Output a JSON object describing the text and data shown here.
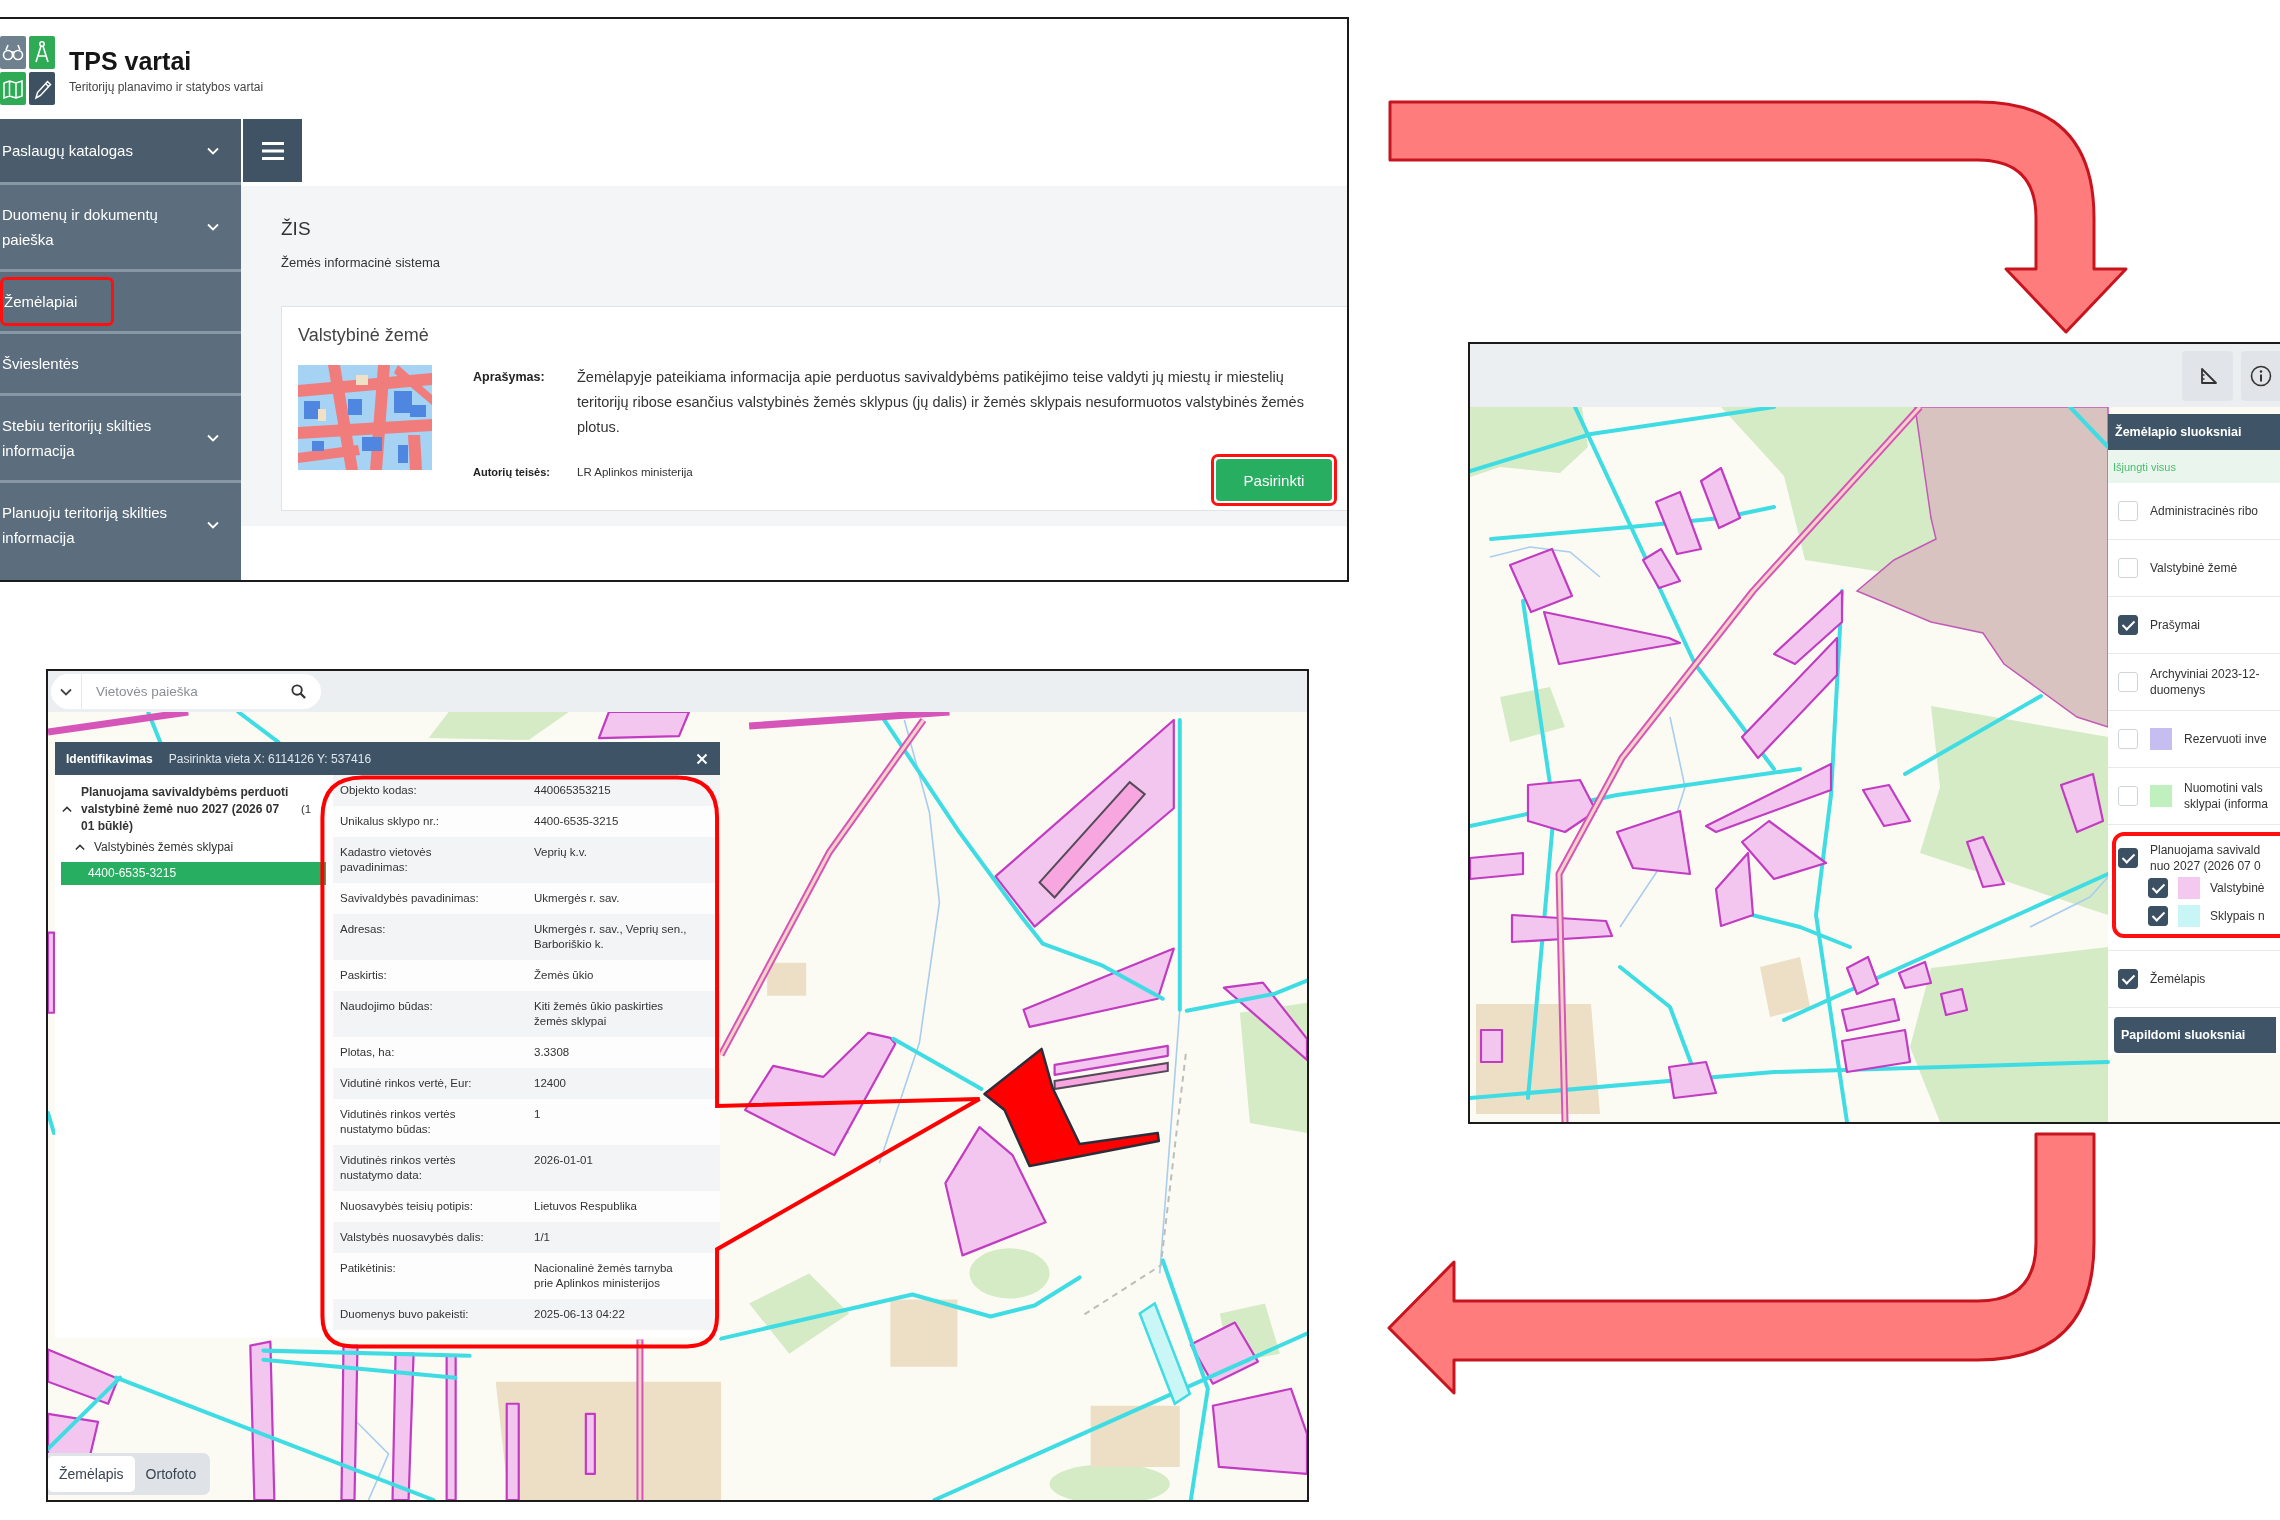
{
  "portal_window": {
    "brand": {
      "title": "TPS vartai",
      "subtitle": "Teritorijų planavimo ir statybos vartai"
    },
    "sidebar": [
      {
        "kind": "heading",
        "label": "Paslaugų katalogas",
        "expandable": true,
        "highlighted": false
      },
      {
        "kind": "entry",
        "label": "Duomenų ir dokumentų paieška",
        "expandable": true,
        "highlighted": false
      },
      {
        "kind": "entry",
        "label": "Žemėlapiai",
        "expandable": false,
        "highlighted": true
      },
      {
        "kind": "entry",
        "label": "Švieslentės",
        "expandable": false,
        "highlighted": false
      },
      {
        "kind": "entry",
        "label": "Stebiu teritorijų skilties informacija",
        "expandable": true,
        "highlighted": false
      },
      {
        "kind": "entry",
        "label": "Planuoju teritoriją skilties informacija",
        "expandable": true,
        "highlighted": false
      }
    ],
    "section": {
      "title": "ŽIS",
      "subtitle": "Žemės informacinė sistema"
    },
    "card": {
      "title": "Valstybinė žemė",
      "fields": [
        {
          "label": "Aprašymas:",
          "value": "Žemėlapyje pateikiama informacija apie perduotus savivaldybėms patikėjimo teise valdyti jų miestų ir miestelių teritorijų ribose esančius valstybinės žemės sklypus (jų dalis) ir žemės sklypais nesuformuotos valstybinės žemės plotus."
        },
        {
          "label": "Autorių teisės:",
          "value": "LR Aplinkos ministerija"
        }
      ],
      "button": {
        "label": "Pasirinkti",
        "highlighted": true
      }
    }
  },
  "layers_window": {
    "layers_panel": {
      "title": "Žemėlapio sluoksniai",
      "toggle_all": "Išjungti visus",
      "layers": [
        {
          "lines": [
            "Administracinės ribo"
          ],
          "checked": false,
          "highlighted": false
        },
        {
          "lines": [
            "Valstybinė žemė"
          ],
          "checked": false,
          "highlighted": false
        },
        {
          "lines": [
            "Prašymai"
          ],
          "checked": true,
          "highlighted": false
        },
        {
          "lines": [
            "Archyviniai 2023-12-",
            "duomenys"
          ],
          "checked": false,
          "highlighted": false
        },
        {
          "lines": [
            "Rezervuoti inve"
          ],
          "checked": false,
          "highlighted": false,
          "color": "#c6bdf0"
        },
        {
          "lines": [
            "Nuomotini vals",
            "sklypai (informa"
          ],
          "checked": false,
          "highlighted": false,
          "color": "#bff0bd"
        },
        {
          "lines": [
            "Planuojama savivald",
            "nuo 2027 (2026 07 0"
          ],
          "checked": true,
          "highlighted": true,
          "children": [
            {
              "lines": [
                "Valstybinė"
              ],
              "checked": true,
              "color": "#f5c8f0"
            },
            {
              "lines": [
                "Sklypais n"
              ],
              "checked": true,
              "color": "#c8f5f5"
            }
          ]
        },
        {
          "lines": [
            "Žemėlapis"
          ],
          "checked": true,
          "highlighted": false
        }
      ],
      "button": "Papildomi sluoksniai"
    }
  },
  "identify_window": {
    "search": {
      "placeholder": "Vietovės paieška"
    },
    "popup": {
      "title": "Identifikavimas",
      "location": "Pasirinkta vieta X: 6114126 Y: 537416",
      "tree": [
        {
          "label": "Planuojama savivaldybėms perduoti valstybinė žemė nuo 2027 (2026 07 01 būklė)",
          "count": "(1",
          "expanded": true,
          "children": [
            {
              "label": "Valstybinės žemės sklypai",
              "expanded": true,
              "children": [
                {
                  "label": "4400-6535-3215",
                  "selected": true
                }
              ]
            }
          ]
        }
      ],
      "properties": [
        {
          "label": "Objekto kodas:",
          "value": "440065353215"
        },
        {
          "label": "Unikalus sklypo nr.:",
          "value": "4400-6535-3215"
        },
        {
          "label": "Kadastro vietovės pavadinimas:",
          "value": "Veprių k.v."
        },
        {
          "label": "Savivaldybės pavadinimas:",
          "value": "Ukmergės r. sav."
        },
        {
          "label": "Adresas:",
          "value": "Ukmergės r. sav., Veprių sen., Barboriškio k."
        },
        {
          "label": "Paskirtis:",
          "value": "Žemės ūkio"
        },
        {
          "label": "Naudojimo būdas:",
          "value": "Kiti žemės ūkio paskirties žemės sklypai"
        },
        {
          "label": "Plotas, ha:",
          "value": "3.3308"
        },
        {
          "label": "Vidutinė rinkos vertė, Eur:",
          "value": "12400"
        },
        {
          "label": "Vidutinės rinkos vertės nustatymo būdas:",
          "value": "1"
        },
        {
          "label": "Vidutinės rinkos vertės nustatymo data:",
          "value": "2026-01-01"
        },
        {
          "label": "Nuosavybės teisių potipis:",
          "value": "Lietuvos Respublika"
        },
        {
          "label": "Valstybės nuosavybės dalis:",
          "value": "1/1"
        },
        {
          "label": "Patikėtinis:",
          "value": "Nacionalinė žemės tarnyba prie Aplinkos ministerijos"
        },
        {
          "label": "Duomenys buvo pakeisti:",
          "value": "2025-06-13 04:22"
        }
      ]
    },
    "map_tabs": [
      {
        "label": "Žemėlapis",
        "selected": true
      },
      {
        "label": "Ortofoto",
        "selected": false
      }
    ]
  }
}
